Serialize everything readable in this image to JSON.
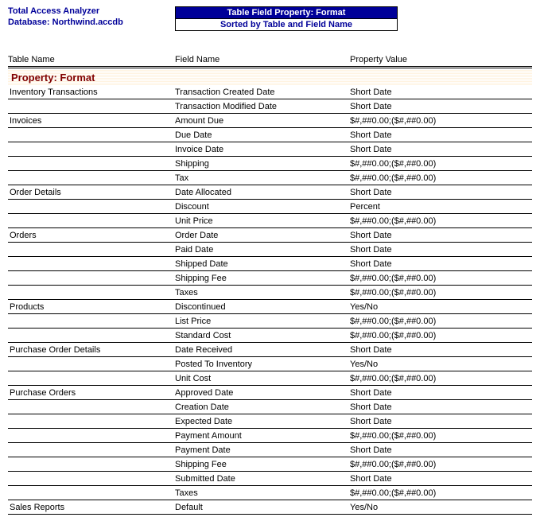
{
  "header": {
    "app_title": "Total Access Analyzer",
    "database_label": "Database: Northwind.accdb",
    "banner": "Table Field Property: Format",
    "subbanner": "Sorted by Table and Field Name"
  },
  "columns": {
    "table_name": "Table Name",
    "field_name": "Field Name",
    "property_value": "Property Value"
  },
  "property_header": "Property: Format",
  "rows": [
    {
      "table": "Inventory Transactions",
      "field": "Transaction Created Date",
      "value": "Short Date"
    },
    {
      "table": "",
      "field": "Transaction Modified Date",
      "value": "Short Date"
    },
    {
      "table": "Invoices",
      "field": "Amount Due",
      "value": "$#,##0.00;($#,##0.00)"
    },
    {
      "table": "",
      "field": "Due Date",
      "value": "Short Date"
    },
    {
      "table": "",
      "field": "Invoice Date",
      "value": "Short Date"
    },
    {
      "table": "",
      "field": "Shipping",
      "value": "$#,##0.00;($#,##0.00)"
    },
    {
      "table": "",
      "field": "Tax",
      "value": "$#,##0.00;($#,##0.00)"
    },
    {
      "table": "Order Details",
      "field": "Date Allocated",
      "value": "Short Date"
    },
    {
      "table": "",
      "field": "Discount",
      "value": "Percent"
    },
    {
      "table": "",
      "field": "Unit Price",
      "value": "$#,##0.00;($#,##0.00)"
    },
    {
      "table": "Orders",
      "field": "Order Date",
      "value": "Short Date"
    },
    {
      "table": "",
      "field": "Paid Date",
      "value": "Short Date"
    },
    {
      "table": "",
      "field": "Shipped Date",
      "value": "Short Date"
    },
    {
      "table": "",
      "field": "Shipping Fee",
      "value": "$#,##0.00;($#,##0.00)"
    },
    {
      "table": "",
      "field": "Taxes",
      "value": "$#,##0.00;($#,##0.00)"
    },
    {
      "table": "Products",
      "field": "Discontinued",
      "value": "Yes/No"
    },
    {
      "table": "",
      "field": "List Price",
      "value": "$#,##0.00;($#,##0.00)"
    },
    {
      "table": "",
      "field": "Standard Cost",
      "value": "$#,##0.00;($#,##0.00)"
    },
    {
      "table": "Purchase Order Details",
      "field": "Date Received",
      "value": "Short Date"
    },
    {
      "table": "",
      "field": "Posted To Inventory",
      "value": "Yes/No"
    },
    {
      "table": "",
      "field": "Unit Cost",
      "value": "$#,##0.00;($#,##0.00)"
    },
    {
      "table": "Purchase Orders",
      "field": "Approved Date",
      "value": "Short Date"
    },
    {
      "table": "",
      "field": "Creation Date",
      "value": "Short Date"
    },
    {
      "table": "",
      "field": "Expected Date",
      "value": "Short Date"
    },
    {
      "table": "",
      "field": "Payment Amount",
      "value": "$#,##0.00;($#,##0.00)"
    },
    {
      "table": "",
      "field": "Payment Date",
      "value": "Short Date"
    },
    {
      "table": "",
      "field": "Shipping Fee",
      "value": "$#,##0.00;($#,##0.00)"
    },
    {
      "table": "",
      "field": "Submitted Date",
      "value": "Short Date"
    },
    {
      "table": "",
      "field": "Taxes",
      "value": "$#,##0.00;($#,##0.00)"
    },
    {
      "table": "Sales Reports",
      "field": "Default",
      "value": "Yes/No"
    }
  ]
}
